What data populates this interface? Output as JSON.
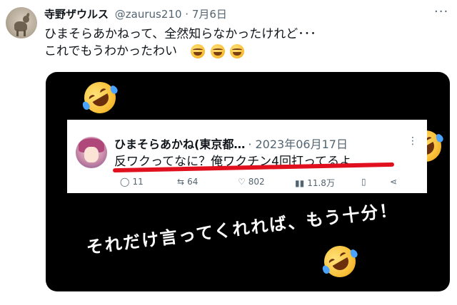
{
  "tweet": {
    "display_name": "寺野ザウルス",
    "handle": "@zaurus210",
    "separator": "·",
    "date": "7月6日",
    "more": "···",
    "text_line1": "ひまそらあかねって、全然知らなかったけれど･･･",
    "text_line2": "これでもうわかったわい",
    "emoji_name": "rolling-on-the-floor-laughing"
  },
  "embedded_tweet": {
    "display_name": "ひまそらあかね(東京都…",
    "date": "· 2023年06月17日",
    "text": "反ワクってなに？俺ワクチン4回打ってるよ",
    "more": "⋮",
    "actions": {
      "replies": "11",
      "retweets": "64",
      "likes": "802",
      "views": "11.8万"
    },
    "underline_color": "#e0101e"
  },
  "image_caption": "それだけ言ってくれれば、もう十分！",
  "colors": {
    "text": "#0f1419",
    "secondary": "#536471",
    "media_bg": "#000000"
  }
}
